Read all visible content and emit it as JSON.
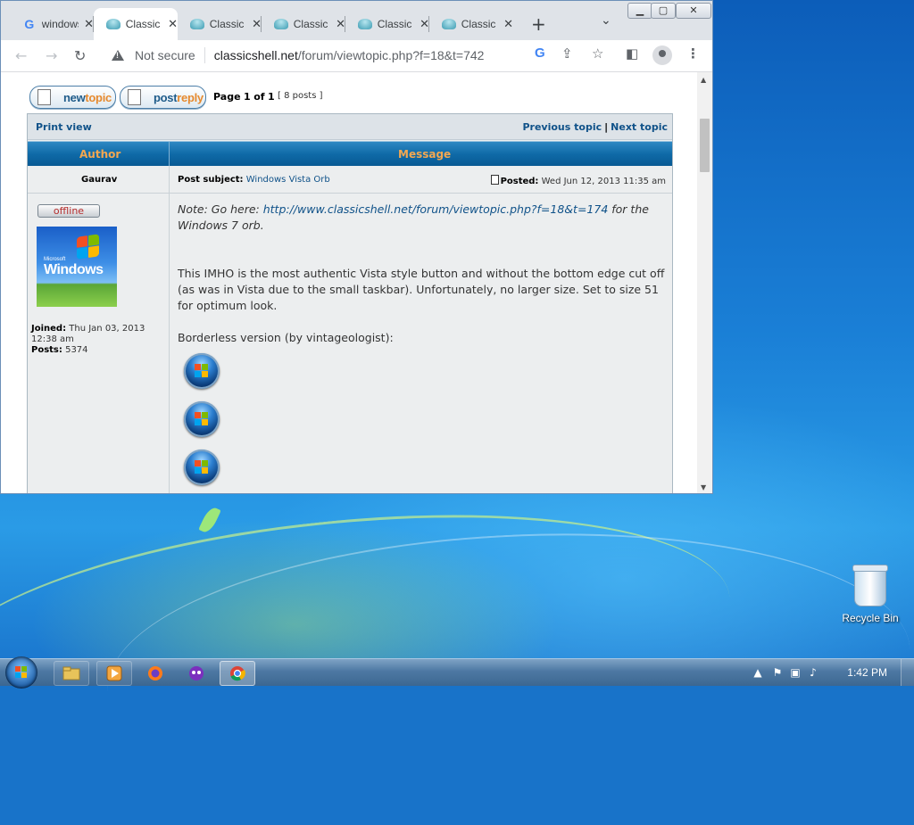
{
  "browser": {
    "tabs": [
      {
        "label": "windows vista orb",
        "favicon": "google-icon",
        "active": false
      },
      {
        "label": "Classic Shell",
        "favicon": "classicshell-icon",
        "active": true
      },
      {
        "label": "Classic Shell",
        "favicon": "classicshell-icon",
        "active": false
      },
      {
        "label": "Classic Shell",
        "favicon": "classicshell-icon",
        "active": false
      },
      {
        "label": "Classic Shell",
        "favicon": "classicshell-icon",
        "active": false
      },
      {
        "label": "Classic Shell",
        "favicon": "classicshell-icon",
        "active": false
      }
    ],
    "tab_close": "✕",
    "new_tab": "+",
    "address": {
      "security": "Not secure",
      "host": "classicshell.net",
      "path": "/forum/viewtopic.php?f=18&t=742"
    }
  },
  "page": {
    "buttons": {
      "newtopic_a": "new",
      "newtopic_b": "topic",
      "postreply_a": "post",
      "postreply_b": "reply"
    },
    "pagination": {
      "label": "Page",
      "current": "1",
      "of": "of",
      "total": "1",
      "posts": "[ 8 posts ]"
    },
    "print_view": "Print view",
    "prev_topic": "Previous topic",
    "next_topic": "Next topic",
    "nav_sep": "|",
    "header": {
      "author": "Author",
      "message": "Message"
    },
    "post": {
      "author": "Gaurav",
      "subject_label": "Post subject:",
      "subject": "Windows Vista Orb",
      "posted_label": "Posted:",
      "posted": "Wed Jun 12, 2013 11:35 am",
      "status": "offline",
      "avatar_brand": "Microsoft",
      "avatar_text": "Windows",
      "joined_label": "Joined:",
      "joined": "Thu Jan 03, 2013 12:38 am",
      "posts_label": "Posts:",
      "posts": "5374",
      "note_prefix": "Note: Go here: ",
      "note_link": "http://www.classicshell.net/forum/viewtopic.php?f=18&t=174",
      "note_suffix": " for the Windows 7 orb.",
      "body1": "This IMHO is the most authentic Vista style button and without the bottom edge cut off (as was in Vista due to the small taskbar). Unfortunately, no larger size. Set to size 51 for optimum look.",
      "body2": "Borderless version (by vintageologist):"
    }
  },
  "desktop": {
    "recycle_bin": "Recycle Bin"
  },
  "taskbar": {
    "clock": "1:42 PM"
  },
  "colors": {
    "forum_header": "#0f6aa7",
    "forum_header_text": "#f3a851",
    "link": "#105289"
  }
}
